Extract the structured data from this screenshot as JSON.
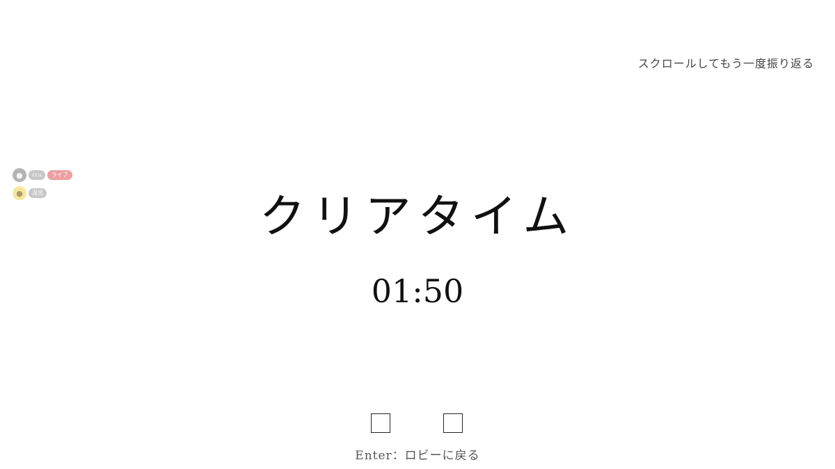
{
  "header": {
    "scroll_hint": "スクロールしてもう一度振り返る"
  },
  "presence": {
    "users": [
      {
        "name": "ccu",
        "badge": "ライブ",
        "avatar_icon": "grey-avatar-icon"
      },
      {
        "name": "温児",
        "badge": "",
        "avatar_icon": "yellow-helmet-avatar-icon"
      }
    ]
  },
  "result": {
    "title": "クリアタイム",
    "time": "01:50"
  },
  "footer": {
    "hint": "Enter：ロビーに戻る"
  },
  "colors": {
    "background": "#ffffff",
    "text": "#111111",
    "live_badge": "#e05252"
  }
}
